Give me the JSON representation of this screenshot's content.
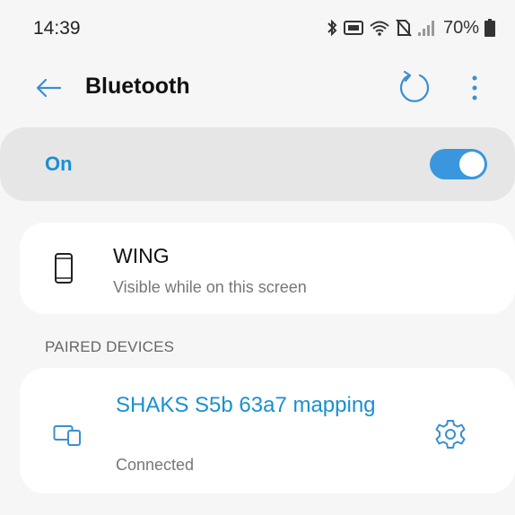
{
  "status_bar": {
    "time": "14:39",
    "battery_percent": "70%",
    "icons": [
      "bluetooth-icon",
      "nfc-icon",
      "wifi-icon",
      "no-sim-icon",
      "signal-icon",
      "battery-icon"
    ]
  },
  "header": {
    "title": "Bluetooth",
    "back_icon": "arrow-left-icon",
    "refresh_icon": "refresh-icon",
    "more_icon": "more-vertical-icon"
  },
  "bluetooth_toggle": {
    "label": "On",
    "enabled": true
  },
  "this_device": {
    "name": "WING",
    "subtitle": "Visible while on this screen",
    "icon": "phone-icon"
  },
  "paired_devices": {
    "header": "PAIRED DEVICES",
    "items": [
      {
        "name": "SHAKS S5b 63a7 mapping",
        "status": "Connected",
        "icon": "devices-icon",
        "settings_icon": "gear-icon"
      }
    ]
  },
  "colors": {
    "accent": "#1a8fd1",
    "toggle_on": "#3a97de",
    "background": "#f6f6f6",
    "card": "#ffffff",
    "on_card": "#e6e6e6"
  }
}
